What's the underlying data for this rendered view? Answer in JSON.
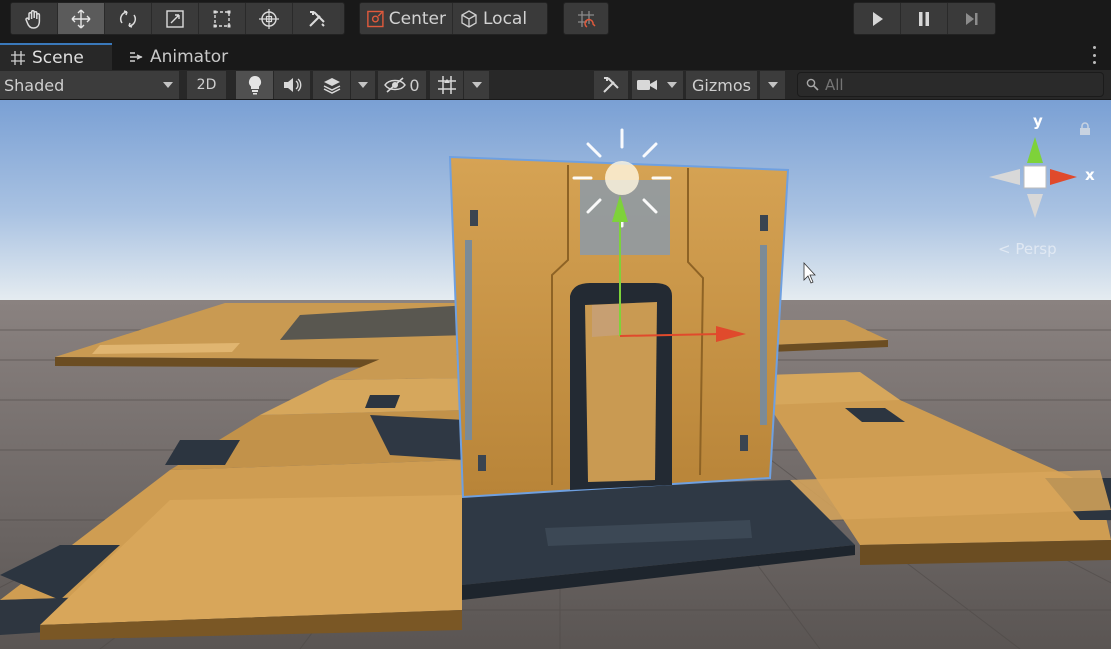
{
  "toolbar": {
    "tools": [
      {
        "name": "hand-tool-button",
        "icon": "hand-icon",
        "active": false
      },
      {
        "name": "move-tool-button",
        "icon": "move-icon",
        "active": true
      },
      {
        "name": "rotate-tool-button",
        "icon": "rotate-icon",
        "active": false
      },
      {
        "name": "scale-tool-button",
        "icon": "scale-icon",
        "active": false
      },
      {
        "name": "rect-tool-button",
        "icon": "rect-icon",
        "active": false
      },
      {
        "name": "transform-tool-button",
        "icon": "transform-icon",
        "active": false
      },
      {
        "name": "custom-tool-button",
        "icon": "tools-icon",
        "active": false
      }
    ],
    "pivot_mode": "Center",
    "pivot_rotation": "Local",
    "play_controls": [
      "play-icon",
      "pause-icon",
      "step-icon"
    ]
  },
  "tabs": [
    {
      "label": "Scene",
      "icon": "grid-icon",
      "active": true
    },
    {
      "label": "Animator",
      "icon": "animator-icon",
      "active": false
    }
  ],
  "scene_toolbar": {
    "draw_mode": "Shaded",
    "mode_2d": "2D",
    "hidden_count": "0",
    "gizmos": "Gizmos",
    "search_placeholder": "All"
  },
  "viewport": {
    "projection": "Persp",
    "axes": {
      "x": "x",
      "y": "y"
    },
    "colors": {
      "sky_top": "#7aa0d4",
      "sky_horizon": "#e6ecef",
      "ground": "#5f5a57",
      "panel": "#c79447",
      "accent_dark": "#2c3540",
      "axis_x": "#e04a2c",
      "axis_y": "#7ed23a",
      "selection": "#6fa0e0"
    }
  }
}
